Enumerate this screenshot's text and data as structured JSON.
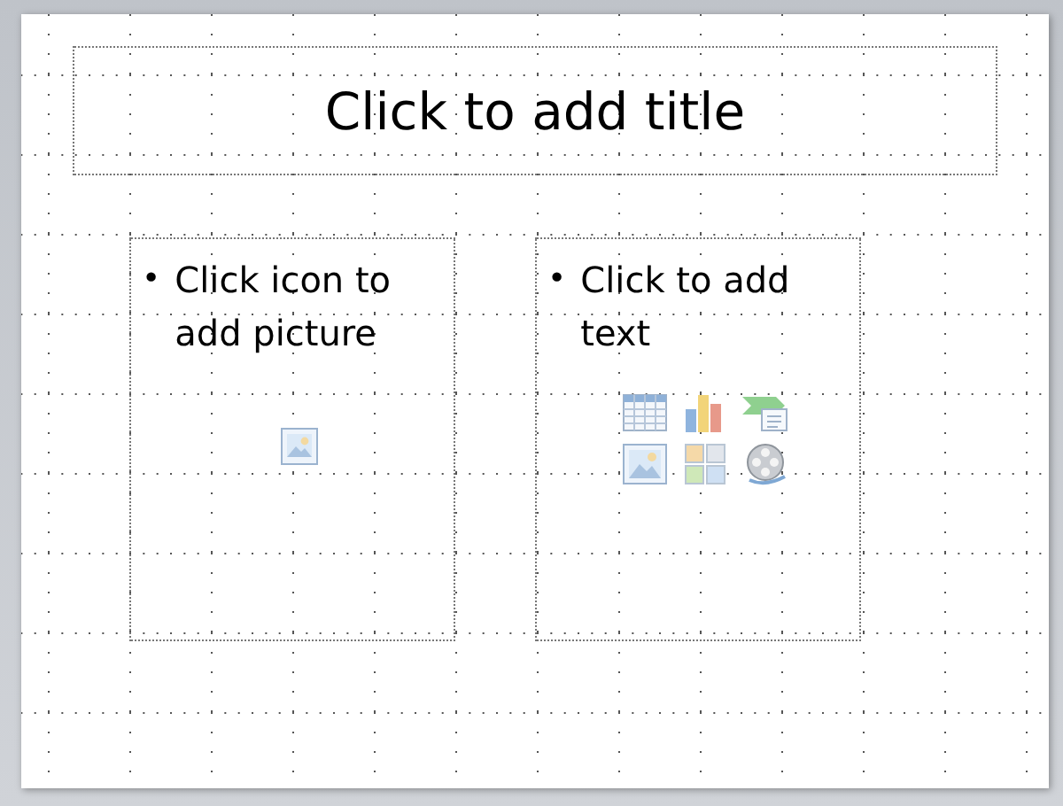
{
  "slide": {
    "title_placeholder": {
      "text": "Click to add title"
    },
    "content_placeholders": [
      {
        "kind": "picture",
        "bullet": "•",
        "text": "Click icon to add picture"
      },
      {
        "kind": "content",
        "bullet": "•",
        "text": "Click to add text"
      }
    ]
  }
}
